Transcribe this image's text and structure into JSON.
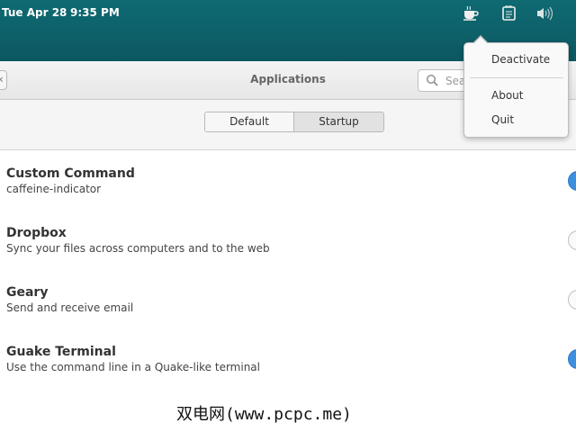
{
  "panel": {
    "date": "Tue Apr 28",
    "time": "9:35 PM",
    "tray_icons": [
      "coffee-cup-icon",
      "clipboard-icon",
      "volume-icon"
    ]
  },
  "window": {
    "title": "Applications",
    "search_placeholder": "Sear",
    "tabs": [
      "Default",
      "Startup"
    ],
    "selected_tab": "Startup"
  },
  "apps": [
    {
      "name": "Custom Command",
      "description": "caffeine-indicator",
      "enabled": true
    },
    {
      "name": "Dropbox",
      "description": "Sync your files across computers and to the web",
      "enabled": false
    },
    {
      "name": "Geary",
      "description": "Send and receive email",
      "enabled": false
    },
    {
      "name": "Guake Terminal",
      "description": "Use the command line in a Quake-like terminal",
      "enabled": true
    }
  ],
  "popover": {
    "items": [
      "Deactivate",
      "About",
      "Quit"
    ]
  },
  "watermark": "双电网(www.pcpc.me)",
  "colors": {
    "wallpaper": "#0f6a72",
    "toggle_on": "#3d8fe0"
  }
}
